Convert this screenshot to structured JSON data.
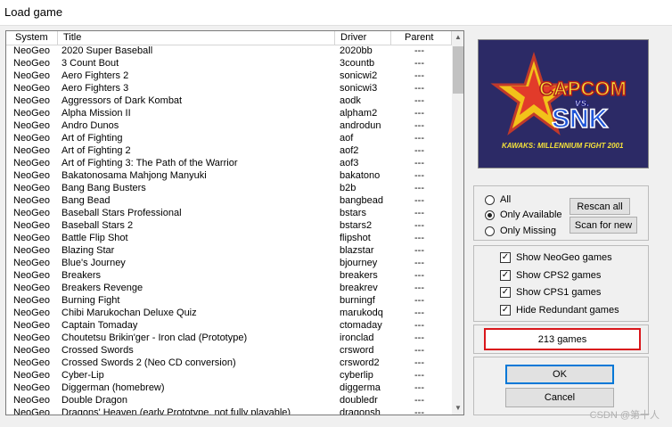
{
  "window": {
    "title": "Load game"
  },
  "table": {
    "headers": {
      "system": "System",
      "title": "Title",
      "driver": "Driver",
      "parent": "Parent"
    },
    "rows": [
      {
        "system": "NeoGeo",
        "title": "2020 Super Baseball",
        "driver": "2020bb",
        "parent": "---"
      },
      {
        "system": "NeoGeo",
        "title": "3 Count Bout",
        "driver": "3countb",
        "parent": "---"
      },
      {
        "system": "NeoGeo",
        "title": "Aero Fighters 2",
        "driver": "sonicwi2",
        "parent": "---"
      },
      {
        "system": "NeoGeo",
        "title": "Aero Fighters 3",
        "driver": "sonicwi3",
        "parent": "---"
      },
      {
        "system": "NeoGeo",
        "title": "Aggressors of Dark Kombat",
        "driver": "aodk",
        "parent": "---"
      },
      {
        "system": "NeoGeo",
        "title": "Alpha Mission II",
        "driver": "alpham2",
        "parent": "---"
      },
      {
        "system": "NeoGeo",
        "title": "Andro Dunos",
        "driver": "androdun",
        "parent": "---"
      },
      {
        "system": "NeoGeo",
        "title": "Art of Fighting",
        "driver": "aof",
        "parent": "---"
      },
      {
        "system": "NeoGeo",
        "title": "Art of Fighting 2",
        "driver": "aof2",
        "parent": "---"
      },
      {
        "system": "NeoGeo",
        "title": "Art of Fighting 3: The Path of the Warrior",
        "driver": "aof3",
        "parent": "---"
      },
      {
        "system": "NeoGeo",
        "title": "Bakatonosama Mahjong Manyuki",
        "driver": "bakatono",
        "parent": "---"
      },
      {
        "system": "NeoGeo",
        "title": "Bang Bang Busters",
        "driver": "b2b",
        "parent": "---"
      },
      {
        "system": "NeoGeo",
        "title": "Bang Bead",
        "driver": "bangbead",
        "parent": "---"
      },
      {
        "system": "NeoGeo",
        "title": "Baseball Stars Professional",
        "driver": "bstars",
        "parent": "---"
      },
      {
        "system": "NeoGeo",
        "title": "Baseball Stars 2",
        "driver": "bstars2",
        "parent": "---"
      },
      {
        "system": "NeoGeo",
        "title": "Battle Flip Shot",
        "driver": "flipshot",
        "parent": "---"
      },
      {
        "system": "NeoGeo",
        "title": "Blazing Star",
        "driver": "blazstar",
        "parent": "---"
      },
      {
        "system": "NeoGeo",
        "title": "Blue's Journey",
        "driver": "bjourney",
        "parent": "---"
      },
      {
        "system": "NeoGeo",
        "title": "Breakers",
        "driver": "breakers",
        "parent": "---"
      },
      {
        "system": "NeoGeo",
        "title": "Breakers Revenge",
        "driver": "breakrev",
        "parent": "---"
      },
      {
        "system": "NeoGeo",
        "title": "Burning Fight",
        "driver": "burningf",
        "parent": "---"
      },
      {
        "system": "NeoGeo",
        "title": "Chibi Marukochan Deluxe Quiz",
        "driver": "marukodq",
        "parent": "---"
      },
      {
        "system": "NeoGeo",
        "title": "Captain Tomaday",
        "driver": "ctomaday",
        "parent": "---"
      },
      {
        "system": "NeoGeo",
        "title": "Choutetsu Brikin'ger - Iron clad (Prototype)",
        "driver": "ironclad",
        "parent": "---"
      },
      {
        "system": "NeoGeo",
        "title": "Crossed Swords",
        "driver": "crsword",
        "parent": "---"
      },
      {
        "system": "NeoGeo",
        "title": "Crossed Swords 2 (Neo CD conversion)",
        "driver": "crsword2",
        "parent": "---"
      },
      {
        "system": "NeoGeo",
        "title": "Cyber-Lip",
        "driver": "cyberlip",
        "parent": "---"
      },
      {
        "system": "NeoGeo",
        "title": "Diggerman (homebrew)",
        "driver": "diggerma",
        "parent": "---"
      },
      {
        "system": "NeoGeo",
        "title": "Double Dragon",
        "driver": "doubledr",
        "parent": "---"
      },
      {
        "system": "NeoGeo",
        "title": "Dragons' Heaven (early Prototype, not fully playable)",
        "driver": "dragonsh",
        "parent": "---"
      }
    ]
  },
  "logo": {
    "line1": "CAPCOM",
    "vs": "vs.",
    "line2": "SNK",
    "subtitle": "KAWAKS: MILLENNIUM FIGHT 2001"
  },
  "filter": {
    "options": [
      "All",
      "Only Available",
      "Only Missing"
    ],
    "selected_index": 1,
    "rescan_label": "Rescan all",
    "scan_new_label": "Scan for new"
  },
  "checks": [
    {
      "label": "Show NeoGeo games",
      "checked": true
    },
    {
      "label": "Show CPS2 games",
      "checked": true
    },
    {
      "label": "Show CPS1 games",
      "checked": true
    },
    {
      "label": "Hide Redundant games",
      "checked": true
    }
  ],
  "status": {
    "count_text": "213 games"
  },
  "buttons": {
    "ok": "OK",
    "cancel": "Cancel"
  },
  "watermark": "CSDN @第十人",
  "colors": {
    "highlight_border": "#d9161b",
    "logo_bg": "#2c2a66",
    "default_button": "#0078d7"
  }
}
